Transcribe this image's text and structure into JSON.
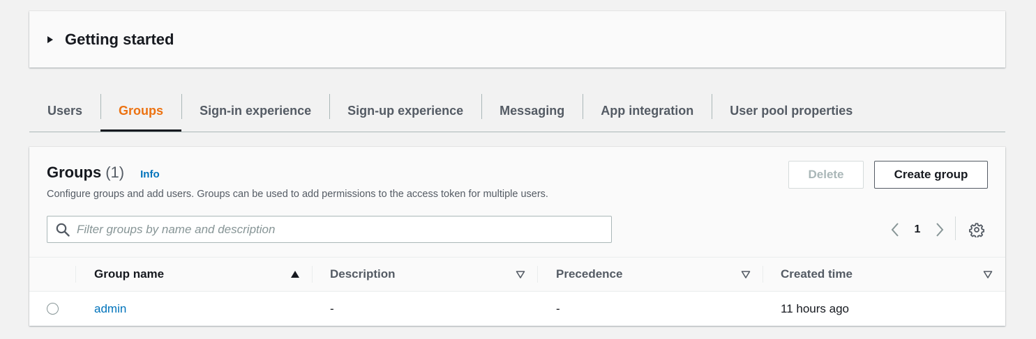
{
  "getting_started": {
    "title": "Getting started"
  },
  "tabs": [
    {
      "label": "Users",
      "active": false
    },
    {
      "label": "Groups",
      "active": true
    },
    {
      "label": "Sign-in experience",
      "active": false
    },
    {
      "label": "Sign-up experience",
      "active": false
    },
    {
      "label": "Messaging",
      "active": false
    },
    {
      "label": "App integration",
      "active": false
    },
    {
      "label": "User pool properties",
      "active": false
    }
  ],
  "groups": {
    "title": "Groups",
    "count": "(1)",
    "info": "Info",
    "description": "Configure groups and add users. Groups can be used to add permissions to the access token for multiple users.",
    "delete_label": "Delete",
    "create_label": "Create group",
    "search_placeholder": "Filter groups by name and description",
    "search_value": "",
    "page": "1"
  },
  "table": {
    "columns": [
      "Group name",
      "Description",
      "Precedence",
      "Created time"
    ],
    "rows": [
      {
        "name": "admin",
        "description": "-",
        "precedence": "-",
        "created": "11 hours ago",
        "selected": false
      }
    ]
  },
  "icons": {
    "expand": "caret-right-icon",
    "search": "search-icon",
    "prev": "chevron-left-icon",
    "next": "chevron-right-icon",
    "settings": "gear-icon",
    "sort_active": "sort-ascending-icon",
    "sort_inactive": "sort-icon"
  },
  "colors": {
    "accent": "#ec7211",
    "link": "#0073bb",
    "background": "#f2f2f2"
  }
}
